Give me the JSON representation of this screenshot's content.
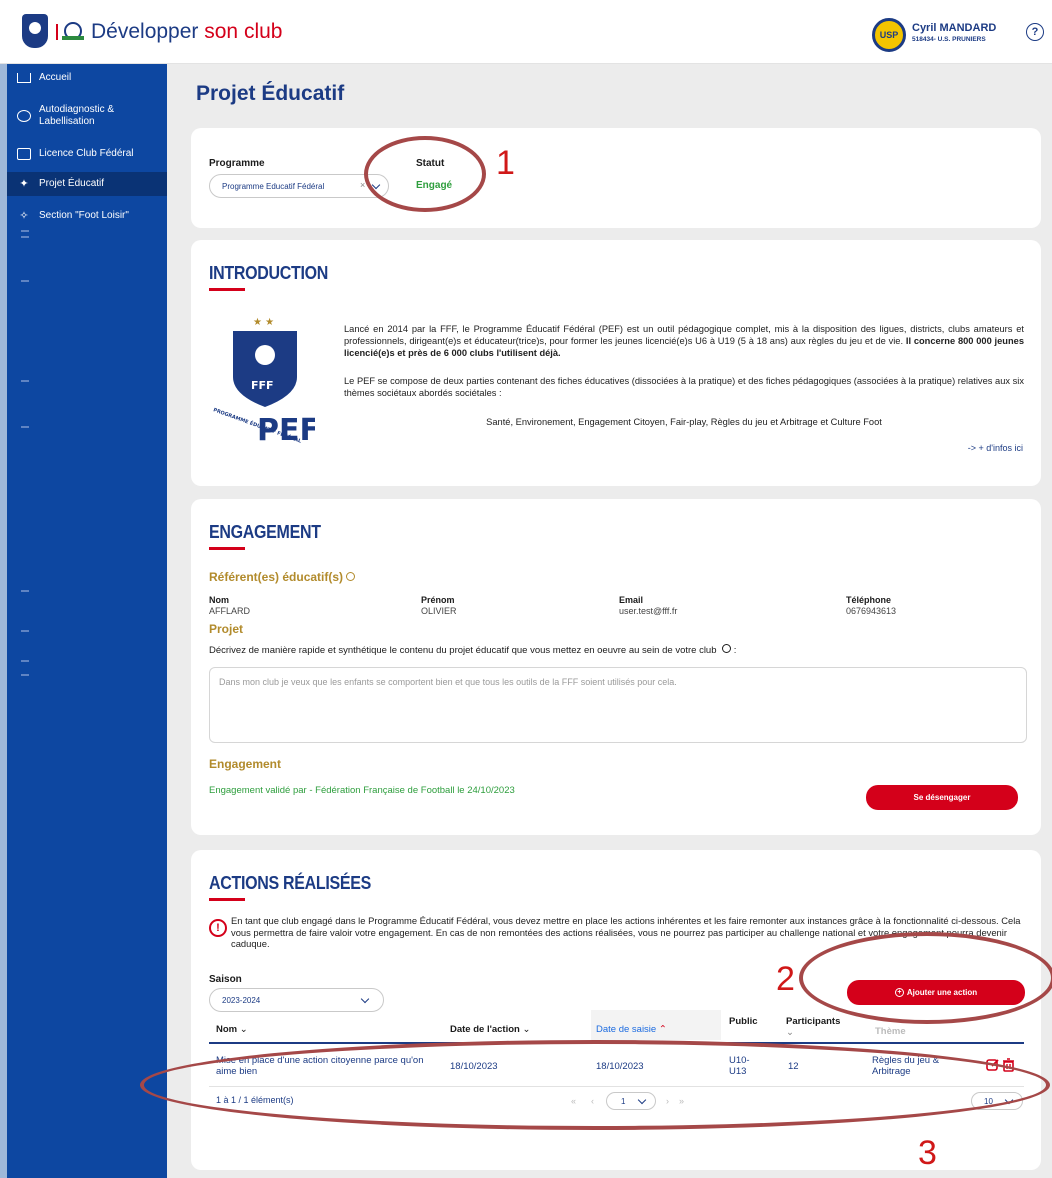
{
  "header": {
    "title_main": "Développer",
    "title_accent": "son club",
    "club_badge": "USP",
    "user_name": "Cyril MANDARD",
    "user_club": "518434- U.S. PRUNIERS",
    "help": "?"
  },
  "sidebar": {
    "items": [
      {
        "label": "Accueil"
      },
      {
        "label": "Autodiagnostic & Labellisation"
      },
      {
        "label": "Licence Club Fédéral"
      },
      {
        "label": "Projet Éducatif"
      },
      {
        "label": "Section \"Foot Loisir\""
      }
    ]
  },
  "page": {
    "title": "Projet Éducatif"
  },
  "programme": {
    "programme_label": "Programme",
    "programme_value": "Programme Educatif Fédéral",
    "statut_label": "Statut",
    "statut_value": "Engagé"
  },
  "introduction": {
    "title": "INTRODUCTION",
    "p1": "Lancé en 2014 par la FFF, le Programme Éducatif Fédéral (PEF) est un outil pédagogique complet, mis à la disposition des ligues, districts, clubs amateurs et professionnels, dirigeant(e)s et éducateur(trice)s, pour former les jeunes licencié(e)s U6 à U19 (5 à 18 ans) aux règles du jeu et de vie.",
    "p1_bold": "Il concerne 800 000 jeunes licencié(e)s et près de 6 000 clubs l'utilisent déjà.",
    "p2": "Le PEF se compose de deux parties contenant des fiches éducatives (dissociées à la pratique) et des fiches pédagogiques (associées à la pratique) relatives aux six thèmes sociétaux abordés sociétales :",
    "themes": "Santé, Environement, Engagement Citoyen, Fair-play, Règles du jeu et Arbitrage et Culture Foot",
    "more_link": "-> + d'infos ici",
    "logo_fff": "FFF",
    "logo_pef": "PEF",
    "logo_side": "PROGRAMME ÉDUCATIF FÉDÉRAL"
  },
  "engagement": {
    "title": "ENGAGEMENT",
    "referents_title": "Référent(es) éducatif(s)",
    "nom_label": "Nom",
    "nom_value": "AFFLARD",
    "prenom_label": "Prénom",
    "prenom_value": "OLIVIER",
    "email_label": "Email",
    "email_value": "user.test@fff.fr",
    "tel_label": "Téléphone",
    "tel_value": "0676943613",
    "projet_title": "Projet",
    "projet_question": "Décrivez de manière rapide et synthétique le contenu du projet éducatif que vous mettez en oeuvre au sein de votre club",
    "projet_text": "Dans mon club je veux que les enfants se comportent bien et que tous les outils de la FFF soient utilisés pour cela.",
    "engagement_title": "Engagement",
    "engagement_status": "Engagement validé par - Fédération Française de Football le 24/10/2023",
    "disengage_button": "Se désengager"
  },
  "actions": {
    "title": "ACTIONS RÉALISÉES",
    "warning": "En tant que club engagé dans le Programme Éducatif Fédéral, vous devez mettre en place les actions inhérentes et les faire remonter aux instances grâce à la fonctionnalité ci-dessous. Cela vous permettra de faire valoir votre engagement. En cas de non remontées des actions réalisées, vous ne pourrez pas participer au challenge national et votre engagement pourra devenir caduque.",
    "saison_label": "Saison",
    "saison_value": "2023-2024",
    "add_button": "Ajouter une action",
    "columns": [
      "Nom",
      "Date de l'action",
      "Date de saisie",
      "Public",
      "Participants",
      "Thème"
    ],
    "rows": [
      {
        "nom": "Mise en place d'une action citoyenne parce qu'on aime bien",
        "date_action": "18/10/2023",
        "date_saisie": "18/10/2023",
        "public": "U10-U13",
        "participants": "12",
        "theme": "Règles du jeu & Arbitrage"
      }
    ],
    "pagination_info": "1 à 1 / 1 élément(s)",
    "page_first": "«",
    "page_prev": "‹",
    "page_current": "1",
    "page_next": "›",
    "page_last": "»",
    "page_size": "10"
  },
  "annotations": [
    "1",
    "2",
    "3"
  ],
  "colors": {
    "brand_blue": "#1c3b84",
    "sidebar_blue": "#0d47a1",
    "red": "#d4001a",
    "green": "#2e9e3d",
    "gold": "#b28b2c",
    "annotation": "#d01818"
  }
}
